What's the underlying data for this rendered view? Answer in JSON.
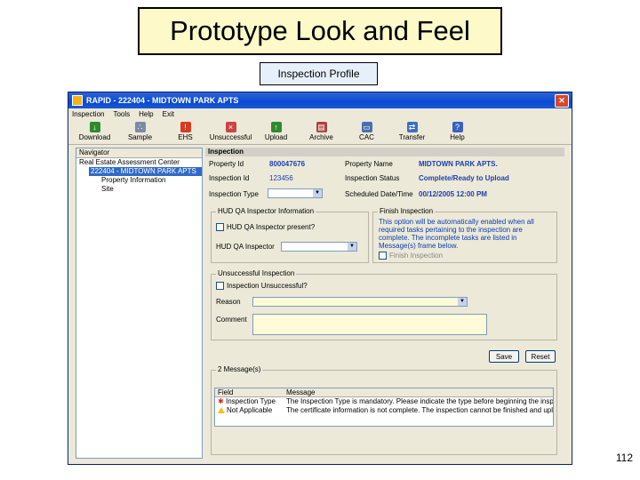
{
  "slide": {
    "title": "Prototype Look and Feel",
    "subtitle": "Inspection Profile",
    "page_number": "112"
  },
  "window": {
    "title": "RAPID - 222404 - MIDTOWN PARK APTS",
    "close_glyph": "✕",
    "menu": [
      "Inspection",
      "Tools",
      "Help",
      "Exit"
    ],
    "toolbar": [
      {
        "label": "Download",
        "icon": "download-icon",
        "color": "#2e8b2e"
      },
      {
        "label": "Sample",
        "icon": "sample-icon",
        "color": "#7a8aa8"
      },
      {
        "label": "EHS",
        "icon": "ehs-warning-icon",
        "color": "#d93a1e"
      },
      {
        "label": "Unsuccessful",
        "icon": "unsuccessful-icon",
        "color": "#c44"
      },
      {
        "label": "Upload",
        "icon": "upload-icon",
        "color": "#2e8b2e"
      },
      {
        "label": "Archive",
        "icon": "archive-icon",
        "color": "#b04040"
      },
      {
        "label": "CAC",
        "icon": "cac-icon",
        "color": "#4a6fb0"
      },
      {
        "label": "Transfer",
        "icon": "transfer-icon",
        "color": "#3a70c0"
      },
      {
        "label": "Help",
        "icon": "help-icon",
        "color": "#3a60c0"
      }
    ]
  },
  "navigator": {
    "header": "Navigator",
    "root": "Real Estate Assessment Center",
    "selected": "222404 - MIDTOWN PARK APTS",
    "children": [
      "Property Information",
      "Site"
    ]
  },
  "inspection": {
    "header": "Inspection",
    "property_id_label": "Property Id",
    "property_id": "800047676",
    "inspection_id_label": "Inspection Id",
    "inspection_id": "123456",
    "inspection_type_label": "Inspection Type",
    "property_name_label": "Property Name",
    "property_name": "MIDTOWN PARK APTS.",
    "inspection_status_label": "Inspection Status",
    "inspection_status": "Complete/Ready to Upload",
    "scheduled_label": "Scheduled Date/Time",
    "scheduled": "00/12/2005 12:00 PM"
  },
  "hud_qa": {
    "group_title": "HUD QA Inspector Information",
    "checkbox_label": "HUD QA Inspector present?",
    "inspector_label": "HUD QA Inspector"
  },
  "finish": {
    "group_title": "Finish Inspection",
    "text": "This option will be automatically enabled when all required tasks pertaining to the inspection are complete. The incomplete tasks are listed in Message(s) frame below.",
    "checkbox_label": "Finish Inspection"
  },
  "unsuccessful": {
    "group_title": "Unsuccessful Inspection",
    "checkbox_label": "Inspection Unsuccessful?",
    "reason_label": "Reason",
    "comment_label": "Comment"
  },
  "buttons": {
    "save": "Save",
    "reset": "Reset"
  },
  "messages": {
    "group_title": "2 Message(s)",
    "col_field": "Field",
    "col_message": "Message",
    "rows": [
      {
        "field": "Inspection Type",
        "message": "The Inspection Type is mandatory. Please indicate the type before beginning the inspection.",
        "icon": "error-icon"
      },
      {
        "field": "Not Applicable",
        "message": "The certificate information is not complete. The inspection cannot be finished and uploaded.",
        "icon": "warning-icon"
      }
    ]
  }
}
